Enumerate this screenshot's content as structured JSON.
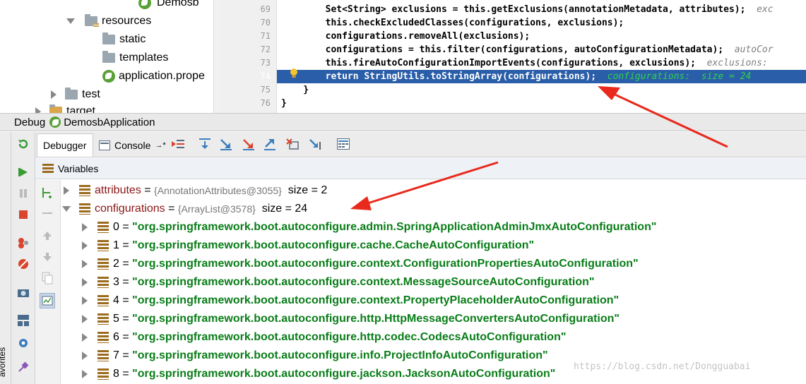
{
  "project_tree": {
    "partial_top_label": "Demosb",
    "items": [
      {
        "label": "resources"
      },
      {
        "label": "static"
      },
      {
        "label": "templates"
      },
      {
        "label": "application.prope"
      },
      {
        "label": "test"
      },
      {
        "label": "target"
      }
    ]
  },
  "editor": {
    "lines": [
      {
        "num": "69",
        "text": "        Set<String> exclusions = this.getExclusions(annotationMetadata, attributes);",
        "hint": "exc"
      },
      {
        "num": "70",
        "text": "        this.checkExcludedClasses(configurations, exclusions);",
        "hint": ""
      },
      {
        "num": "71",
        "text": "        configurations.removeAll(exclusions);",
        "hint": ""
      },
      {
        "num": "72",
        "text": "        configurations = this.filter(configurations, autoConfigurationMetadata);",
        "hint": "autoCor"
      },
      {
        "num": "73",
        "text": "        this.fireAutoConfigurationImportEvents(configurations, exclusions);",
        "hint": "exclusions:"
      },
      {
        "num": "74",
        "text": "        return StringUtils.toStringArray(configurations);",
        "hint": "configurations:  size = 24"
      },
      {
        "num": "75",
        "text": "    }",
        "hint": ""
      },
      {
        "num": "76",
        "text": "}",
        "hint": ""
      }
    ]
  },
  "debug": {
    "title": "Debug",
    "config_name": "DemosbApplication",
    "tabs": {
      "debugger": "Debugger",
      "console": "Console"
    },
    "variables_title": "Variables"
  },
  "variables": [
    {
      "name": "attributes",
      "ref": "{AnnotationAttributes@3055}",
      "size": "size = 2"
    },
    {
      "name": "configurations",
      "ref": "{ArrayList@3578}",
      "size": "size = 24"
    }
  ],
  "config_items": [
    {
      "idx": "0",
      "value": "\"org.springframework.boot.autoconfigure.admin.SpringApplicationAdminJmxAutoConfiguration\""
    },
    {
      "idx": "1",
      "value": "\"org.springframework.boot.autoconfigure.cache.CacheAutoConfiguration\""
    },
    {
      "idx": "2",
      "value": "\"org.springframework.boot.autoconfigure.context.ConfigurationPropertiesAutoConfiguration\""
    },
    {
      "idx": "3",
      "value": "\"org.springframework.boot.autoconfigure.context.MessageSourceAutoConfiguration\""
    },
    {
      "idx": "4",
      "value": "\"org.springframework.boot.autoconfigure.context.PropertyPlaceholderAutoConfiguration\""
    },
    {
      "idx": "5",
      "value": "\"org.springframework.boot.autoconfigure.http.HttpMessageConvertersAutoConfiguration\""
    },
    {
      "idx": "6",
      "value": "\"org.springframework.boot.autoconfigure.http.codec.CodecsAutoConfiguration\""
    },
    {
      "idx": "7",
      "value": "\"org.springframework.boot.autoconfigure.info.ProjectInfoAutoConfiguration\""
    },
    {
      "idx": "8",
      "value": "\"org.springframework.boot.autoconfigure.jackson.JacksonAutoConfiguration\""
    }
  ],
  "sidebar_label": "avorites",
  "watermark": "https://blog.csdn.net/Dongguabai",
  "colors": {
    "current_line": "#2a5ea8",
    "string_value": "#097d18",
    "var_name": "#8b1616",
    "arrow": "#e8291c"
  }
}
